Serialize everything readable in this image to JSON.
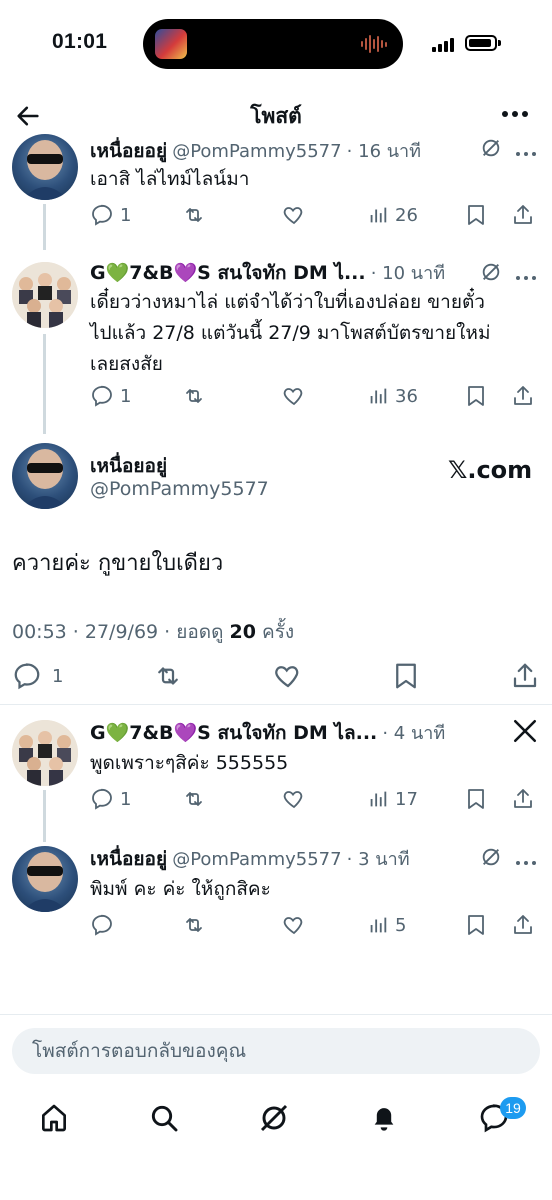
{
  "status_bar": {
    "time": "01:01"
  },
  "header": {
    "title": "โพสต์"
  },
  "thread_top": [
    {
      "author": "เหนื่อยอยู่",
      "handle": "@PomPammy5577",
      "time": "· 16 นาที",
      "text": "เอาสิ ไล่ไทม์ไลน์มา",
      "replies": "1",
      "views": "26"
    },
    {
      "author": "G💚7&B💜S สนใจทัก DM ไ...",
      "time": "· 10 นาที",
      "text_lines": [
        "เดี๋ยวว่างหมาไล่ แต่จำได้ว่าใบที่เองปล่อย ขายตั๋ว",
        "ไปแล้ว 27/8 แต่วันนี้ 27/9 มาโพสต์บัตรขายใหม่",
        "เลยสงสัย"
      ],
      "replies": "1",
      "views": "36"
    }
  ],
  "main_post": {
    "author": "เหนื่อยอยู่",
    "handle": "@PomPammy5577",
    "watermark": "𝕏.com",
    "text": "ควายค่ะ กูขายใบเดียว",
    "timestamp": "00:53 · 27/9/69 · ยอดดู",
    "views": "20",
    "views_suffix": "ครั้ง",
    "replies": "1"
  },
  "replies": [
    {
      "author": "G💚7&B💜S สนใจทัก DM ไล...",
      "time": "· 4 นาที",
      "text": "พูดเพราะๆสิค่ะ 555555",
      "replies": "1",
      "views": "17"
    },
    {
      "author": "เหนื่อยอยู่",
      "handle": "@PomPammy5577",
      "time": "· 3 นาที",
      "text": "พิมพ์ คะ ค่ะ ให้ถูกสิคะ",
      "views": "5"
    }
  ],
  "reply_box": {
    "placeholder": "โพสต์การตอบกลับของคุณ"
  },
  "bottom_nav": {
    "messages_badge": "19"
  },
  "colors": {
    "accent": "#1d9bf0",
    "text": "#0f1419",
    "muted": "#536471"
  }
}
